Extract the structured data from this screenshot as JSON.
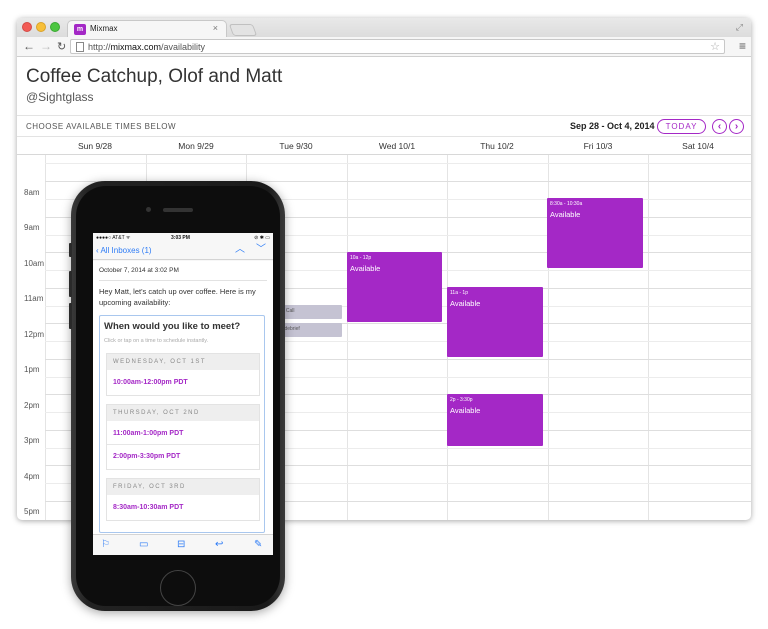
{
  "browser": {
    "tab_title": "Mixmax",
    "tab_close": "×",
    "tab_logo": "m",
    "url_prefix": "http://",
    "url_domain": "mixmax.com",
    "url_path": "/availability"
  },
  "page": {
    "title": "Coffee Catchup, Olof and Matt",
    "subtitle": "@Sightglass"
  },
  "calendar": {
    "instruction": "CHOOSE AVAILABLE TIMES BELOW",
    "range": "Sep 28 - Oct 4, 2014",
    "today_label": "TODAY",
    "prev_label": "‹",
    "next_label": "›",
    "days": [
      "Sun 9/28",
      "Mon 9/29",
      "Tue 9/30",
      "Wed 10/1",
      "Thu 10/2",
      "Fri 10/3",
      "Sat 10/4"
    ],
    "hours": [
      "8am",
      "9am",
      "10am",
      "11am",
      "12pm",
      "1pm",
      "2pm",
      "3pm",
      "4pm",
      "5pm"
    ],
    "events": [
      {
        "time": "10a - 12p",
        "title": "Available"
      },
      {
        "time": "11a - 1p",
        "title": "Available"
      },
      {
        "time": "2p - 3:30p",
        "title": "Available"
      },
      {
        "time": "8:30a - 10:30a",
        "title": "Available"
      }
    ],
    "busy_events": [
      "s Call",
      "l debrief"
    ],
    "accent_color": "#a428c6"
  },
  "phone": {
    "status": {
      "carrier": "●●●●○ AT&T ᯤ",
      "time": "3:03 PM",
      "battery": "⊘ ✱ ▭"
    },
    "nav": {
      "back_label": "‹ All Inboxes (1)"
    },
    "mail": {
      "date": "October 7, 2014 at 3:02 PM",
      "body": "Hey Matt, let's catch up over coffee. Here is my upcoming availability:",
      "meet_title": "When would you like to meet?",
      "meet_hint": "Click or tap on a time to schedule instantly.",
      "days": [
        {
          "label": "WEDNESDAY, OCT 1ST",
          "slots": [
            "10:00am-12:00pm PDT"
          ]
        },
        {
          "label": "THURSDAY, OCT 2ND",
          "slots": [
            "11:00am-1:00pm PDT",
            "2:00pm-3:30pm PDT"
          ]
        },
        {
          "label": "FRIDAY, OCT 3RD",
          "slots": [
            "8:30am-10:30am PDT"
          ]
        }
      ]
    },
    "link_color": "#2e7cf6"
  }
}
